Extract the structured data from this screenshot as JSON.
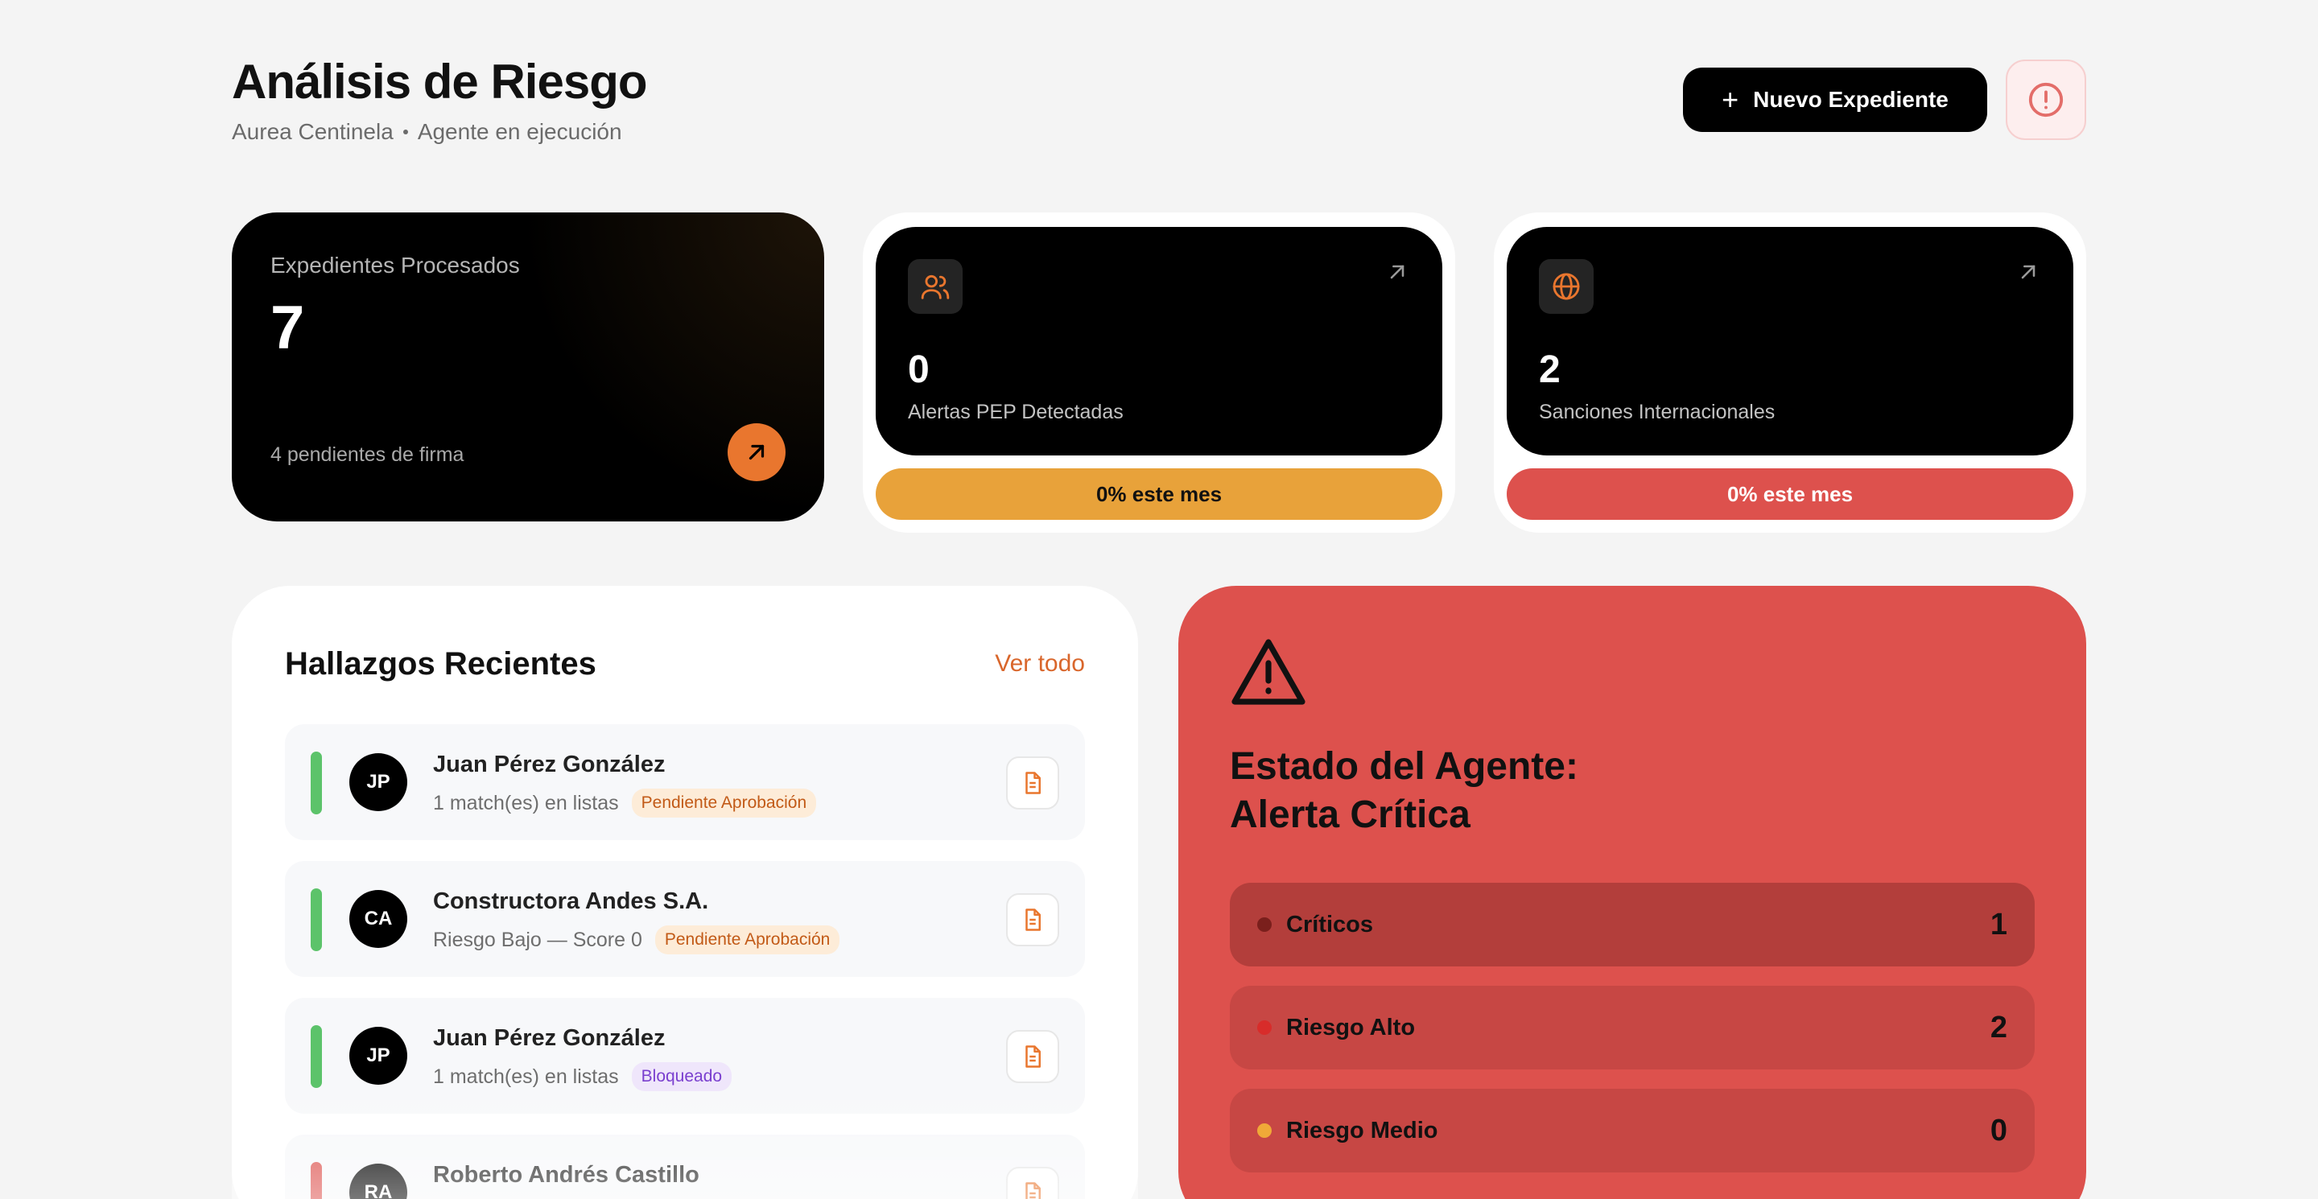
{
  "header": {
    "title": "Análisis de Riesgo",
    "org": "Aurea Centinela",
    "status": "Agente en ejecución",
    "new_button_label": "Nuevo Expediente"
  },
  "stats": {
    "processed": {
      "label": "Expedientes Procesados",
      "value": "7",
      "footer": "4 pendientes de firma"
    },
    "pep": {
      "value": "0",
      "label": "Alertas PEP Detectadas",
      "pill": "0% este mes",
      "pill_color": "#e8a23a"
    },
    "sanctions": {
      "value": "2",
      "label": "Sanciones Internacionales",
      "pill": "0% este mes",
      "pill_color": "#dd514d"
    }
  },
  "findings": {
    "title": "Hallazgos Recientes",
    "view_all": "Ver todo",
    "rows": [
      {
        "initials": "JP",
        "name": "Juan Pérez González",
        "detail": "1 match(es) en listas",
        "badge": "Pendiente Aprobación",
        "bar_color": "#5cc36a"
      },
      {
        "initials": "CA",
        "name": "Constructora Andes S.A.",
        "detail": "Riesgo Bajo — Score 0",
        "badge": "Pendiente Aprobación",
        "bar_color": "#5cc36a"
      },
      {
        "initials": "JP",
        "name": "Juan Pérez González",
        "detail": "1 match(es) en listas",
        "badge": "Bloqueado",
        "bar_color": "#5cc36a"
      },
      {
        "initials": "RA",
        "name": "Roberto Andrés Castillo",
        "detail": "",
        "badge": "",
        "bar_color": "#dd514d"
      }
    ]
  },
  "agent": {
    "title_line1": "Estado del Agente:",
    "title_line2": "Alerta Crítica",
    "levels": [
      {
        "label": "Críticos",
        "value": "1",
        "dot": "#7a1f1c",
        "bg": "#b33e3b"
      },
      {
        "label": "Riesgo Alto",
        "value": "2",
        "dot": "#d82c2a",
        "bg": "#c74744"
      },
      {
        "label": "Riesgo Medio",
        "value": "0",
        "dot": "#f0a938",
        "bg": "#c74744"
      }
    ]
  }
}
